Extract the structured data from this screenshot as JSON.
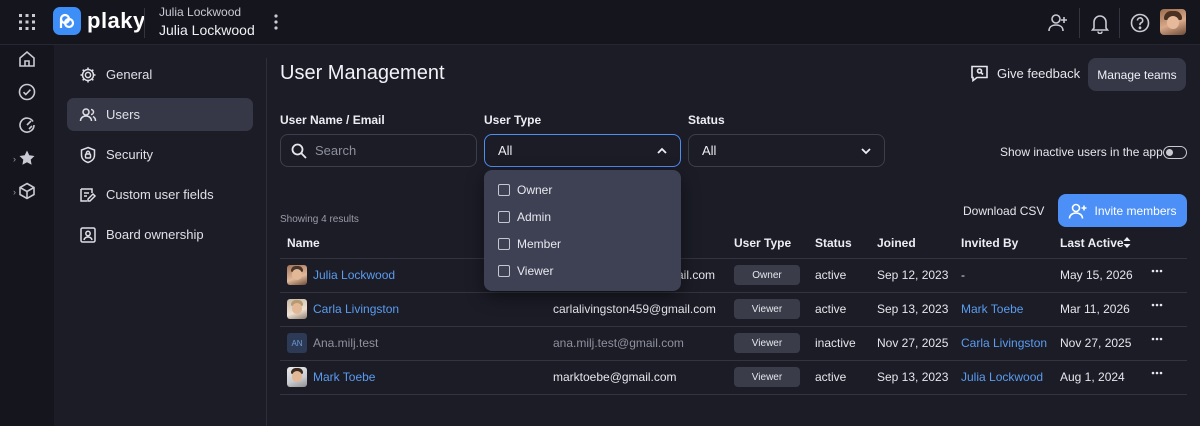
{
  "app": {
    "logo_text": "plaky",
    "accent_color": "#3d8ef7"
  },
  "workspace": {
    "small_label": "Julia Lockwood",
    "name": "Julia Lockwood"
  },
  "topbar_icons": [
    "grid-icon",
    "add-user-icon",
    "bell-icon",
    "help-icon"
  ],
  "rail_icons": [
    "home-icon",
    "check-circle-icon",
    "recent-icon",
    "star-icon",
    "box-icon"
  ],
  "settings_nav": [
    {
      "label": "General",
      "icon": "gear-icon"
    },
    {
      "label": "Users",
      "icon": "users-icon",
      "active": true
    },
    {
      "label": "Security",
      "icon": "shield-icon"
    },
    {
      "label": "Custom user fields",
      "icon": "custom-field-icon"
    },
    {
      "label": "Board ownership",
      "icon": "board-icon"
    }
  ],
  "page": {
    "title": "User Management",
    "feedback_label": "Give feedback",
    "manage_teams_label": "Manage teams"
  },
  "filters": {
    "name_label": "User Name / Email",
    "search_placeholder": "Search",
    "user_type_label": "User Type",
    "user_type_value": "All",
    "status_label": "Status",
    "status_value": "All",
    "show_inactive_label": "Show inactive users in the app"
  },
  "user_type_options": [
    "Owner",
    "Admin",
    "Member",
    "Viewer"
  ],
  "toolbar": {
    "results_text": "Showing 4 results",
    "download_label": "Download CSV",
    "invite_label": "Invite members"
  },
  "table": {
    "headers": {
      "name": "Name",
      "user_type": "User Type",
      "status": "Status",
      "joined": "Joined",
      "invited_by": "Invited By",
      "last_active": "Last Active"
    },
    "rows": [
      {
        "name": "Julia Lockwood",
        "email_visible": "ail.com",
        "user_type": "Owner",
        "status": "active",
        "joined": "Sep 12, 2023",
        "invited_by": "-",
        "last_active": "May 15, 2026"
      },
      {
        "name": "Carla Livingston",
        "email": "carlalivingston459@gmail.com",
        "user_type": "Viewer",
        "status": "active",
        "joined": "Sep 13, 2023",
        "invited_by": "Mark Toebe",
        "last_active": "Mar 11, 2026"
      },
      {
        "name": "Ana.milj.test",
        "initials": "AN",
        "email": "ana.milj.test@gmail.com",
        "user_type": "Viewer",
        "status": "inactive",
        "joined": "Nov 27, 2025",
        "invited_by": "Carla Livingston",
        "last_active": "Nov 27, 2025"
      },
      {
        "name": "Mark Toebe",
        "email": "marktoebe@gmail.com",
        "user_type": "Viewer",
        "status": "active",
        "joined": "Sep 13, 2023",
        "invited_by": "Julia Lockwood",
        "last_active": "Aug 1, 2024"
      }
    ]
  }
}
